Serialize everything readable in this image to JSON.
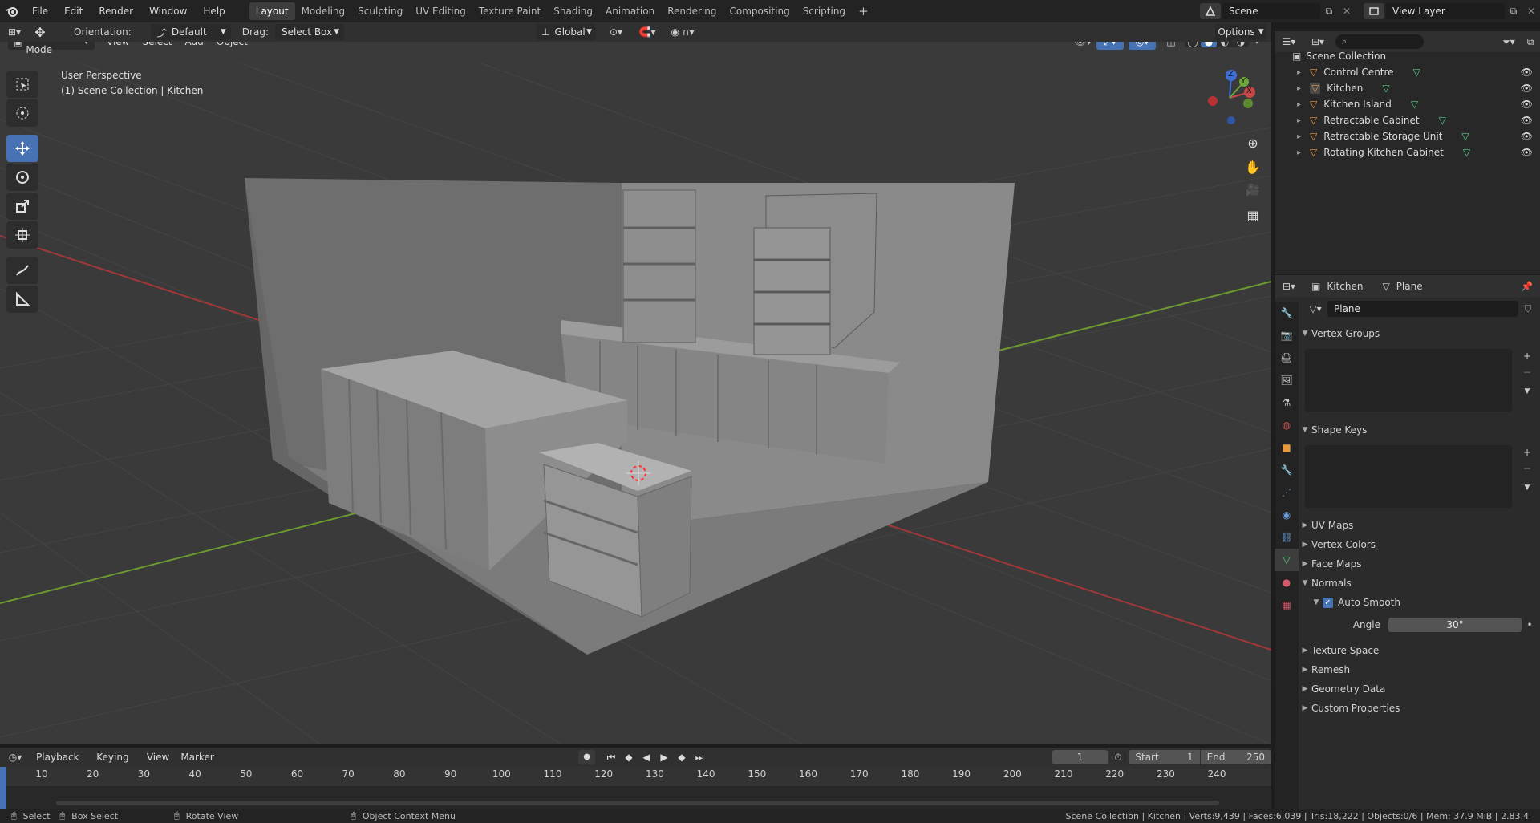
{
  "topbar": {
    "menus": [
      "File",
      "Edit",
      "Render",
      "Window",
      "Help"
    ],
    "workspaces": [
      "Layout",
      "Modeling",
      "Sculpting",
      "UV Editing",
      "Texture Paint",
      "Shading",
      "Animation",
      "Rendering",
      "Compositing",
      "Scripting"
    ],
    "active_workspace": "Layout",
    "add_tab": "+",
    "scene": "Scene",
    "view_layer": "View Layer"
  },
  "tool_header": {
    "orientation_label": "Orientation:",
    "orientation_value": "Default",
    "drag_label": "Drag:",
    "drag_value": "Select Box",
    "transform_orientation": "Global",
    "options": "Options"
  },
  "viewport_header": {
    "mode": "Object Mode",
    "view": "View",
    "select": "Select",
    "add": "Add",
    "object": "Object"
  },
  "viewport": {
    "perspective": "User Perspective",
    "collection_info": "(1) Scene Collection | Kitchen",
    "gizmo": {
      "z": "Z",
      "x": "X",
      "y": "Y"
    }
  },
  "outliner": {
    "root": "Scene Collection",
    "items": [
      "Control Centre",
      "Kitchen",
      "Kitchen Island",
      "Retractable Cabinet",
      "Retractable Storage Unit",
      "Rotating Kitchen Cabinet"
    ],
    "selected": "Kitchen"
  },
  "properties": {
    "breadcrumb_object": "Kitchen",
    "breadcrumb_data": "Plane",
    "mesh_name": "Plane",
    "panels": {
      "vertex_groups": "Vertex Groups",
      "shape_keys": "Shape Keys",
      "uv_maps": "UV Maps",
      "vertex_colors": "Vertex Colors",
      "face_maps": "Face Maps",
      "normals": "Normals",
      "auto_smooth": "Auto Smooth",
      "angle_label": "Angle",
      "angle_value": "30°",
      "texture_space": "Texture Space",
      "remesh": "Remesh",
      "geometry_data": "Geometry Data",
      "custom_properties": "Custom Properties"
    }
  },
  "timeline": {
    "playback": "Playback",
    "keying": "Keying",
    "view": "View",
    "marker": "Marker",
    "current_frame": "1",
    "start_label": "Start",
    "start_value": "1",
    "end_label": "End",
    "end_value": "250",
    "ticks": [
      "10",
      "20",
      "30",
      "40",
      "50",
      "60",
      "70",
      "80",
      "90",
      "100",
      "110",
      "120",
      "130",
      "140",
      "150",
      "160",
      "170",
      "180",
      "190",
      "200",
      "210",
      "220",
      "230",
      "240"
    ]
  },
  "statusbar": {
    "select": "Select",
    "box_select": "Box Select",
    "rotate_view": "Rotate View",
    "context_menu": "Object Context Menu",
    "stats": "Scene Collection | Kitchen | Verts:9,439 | Faces:6,039 | Tris:18,222 | Objects:0/6 | Mem: 37.9 MiB | 2.83.4"
  },
  "colors": {
    "accent": "#4772b3",
    "object_orange": "#e99a3c",
    "mesh_green": "#5bd08a",
    "x_axis": "#c24040",
    "y_axis": "#6b9a2f"
  }
}
